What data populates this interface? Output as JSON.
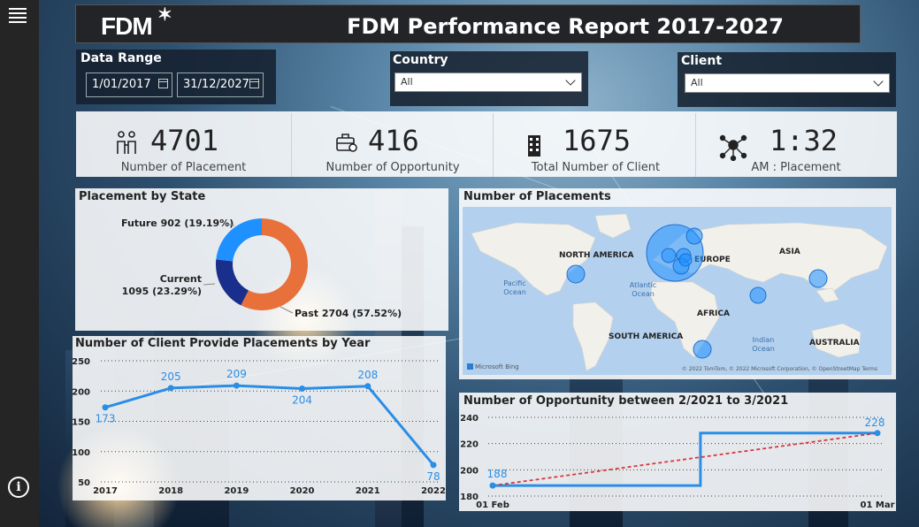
{
  "header": {
    "logo": "FDM",
    "title": "FDM Performance Report 2017-2027"
  },
  "filters": {
    "date_range": {
      "label": "Data Range",
      "start": "1/01/2017",
      "end": "31/12/2027"
    },
    "country": {
      "label": "Country",
      "value": "All"
    },
    "client": {
      "label": "Client",
      "value": "All"
    }
  },
  "kpis": [
    {
      "value": "4701",
      "label": "Number of Placement",
      "icon": "people-icon"
    },
    {
      "value": "416",
      "label": "Number of Opportunity",
      "icon": "briefcase-icon"
    },
    {
      "value": "1675",
      "label": "Total Number of Client",
      "icon": "building-icon"
    },
    {
      "value": "1:32",
      "label": "AM : Placement",
      "icon": "network-icon"
    }
  ],
  "map": {
    "title": "Number of Placements",
    "labels": {
      "north_america": "NORTH AMERICA",
      "europe": "EUROPE",
      "asia": "ASIA",
      "pacific": "Pacific Ocean",
      "atlantic": "Atlantic Ocean",
      "africa": "AFRICA",
      "south_america": "SOUTH AMERICA",
      "indian": "Indian Ocean",
      "australia": "AUSTRALIA"
    },
    "attribution": "© 2022 TomTom, © 2022 Microsoft Corporation, © OpenStreetMap Terms",
    "bing": "Microsoft Bing"
  },
  "chart_data": [
    {
      "type": "pie",
      "title": "Placement by State",
      "categories": [
        "Future",
        "Current",
        "Past"
      ],
      "values": [
        902,
        1095,
        2704
      ],
      "labels": [
        "Future 902 (19.19%)",
        "Current 1095 (23.29%)",
        "Past 2704 (57.52%)"
      ],
      "colors": [
        "#1a2e8c",
        "#1e90ff",
        "#e8703a"
      ]
    },
    {
      "type": "line",
      "title": "Number of Client Provide Placements by Year",
      "x": [
        "2017",
        "2018",
        "2019",
        "2020",
        "2021",
        "2022"
      ],
      "series": [
        {
          "values": [
            173,
            205,
            209,
            204,
            208,
            78
          ]
        }
      ],
      "ylim": [
        50,
        250
      ],
      "yticks": [
        "50",
        "100",
        "150",
        "200",
        "250"
      ],
      "grid": true,
      "color": "#2a8ee6"
    },
    {
      "type": "line",
      "title": "Number of Opportunity between 2/2021 to 3/2021",
      "x": [
        "01 Feb",
        "01 Mar"
      ],
      "series": [
        {
          "values": [
            188,
            228
          ]
        }
      ],
      "trend": true,
      "ylim": [
        180,
        240
      ],
      "yticks": [
        "180",
        "200",
        "220",
        "240"
      ],
      "data_labels": [
        "188",
        "228"
      ],
      "color": "#2a8ee6",
      "trend_color": "#d9373d"
    }
  ]
}
